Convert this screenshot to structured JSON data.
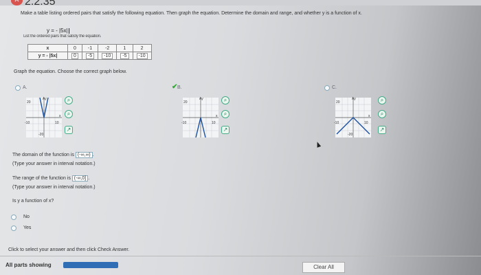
{
  "header": {
    "problem_number": "2.2.35"
  },
  "instructions": "Make a table listing ordered pairs that satisfy the following equation. Then graph the equation. Determine the domain and range, and whether y is a function of x.",
  "equation": "y = - |5x|",
  "table_caption_partial": "List the ordered pairs that satisfy the equation.",
  "table": {
    "x_header": "x",
    "y_header": "y = - |5x|",
    "x_values": [
      "0",
      "-1",
      "-2",
      "1",
      "2"
    ],
    "y_values": [
      "0",
      "-5",
      "-10",
      "-5",
      "-10"
    ]
  },
  "graph_prompt": "Graph the equation. Choose the correct graph below.",
  "options": [
    {
      "label": "A.",
      "selected": false,
      "y_tick": "20",
      "x_left": "-10",
      "x_right": "10",
      "y_bottom": "-20",
      "axis_x": "x",
      "axis_y": "Ay"
    },
    {
      "label": "B.",
      "selected": true,
      "y_tick": "20",
      "x_left": "-10",
      "x_right": "10",
      "axis_x": "x",
      "axis_y": "Ay"
    },
    {
      "label": "C.",
      "selected": false,
      "y_tick": "20",
      "x_left": "-10",
      "x_right": "10",
      "y_bottom": "-20",
      "axis_x": "x",
      "axis_y": "Ay"
    }
  ],
  "domain": {
    "prefix": "The domain of the function is",
    "value": "(-∞,∞)",
    "suffix": ".",
    "hint": "(Type your answer in interval notation.)"
  },
  "range": {
    "prefix": "The range of the function is",
    "value": "(-∞,0]",
    "suffix": ".",
    "hint": "(Type your answer in interval notation.)"
  },
  "function_question": "Is y a function of x?",
  "function_choices": [
    "No",
    "Yes"
  ],
  "footer": {
    "hint": "Click to select your answer and then click Check Answer.",
    "parts_label": "All parts showing",
    "clear_all": "Clear All"
  },
  "colors": {
    "accent": "#2f6db5",
    "correct": "#3a3",
    "wrong": "#d9534f",
    "graph_line": "#1a4fa0"
  }
}
